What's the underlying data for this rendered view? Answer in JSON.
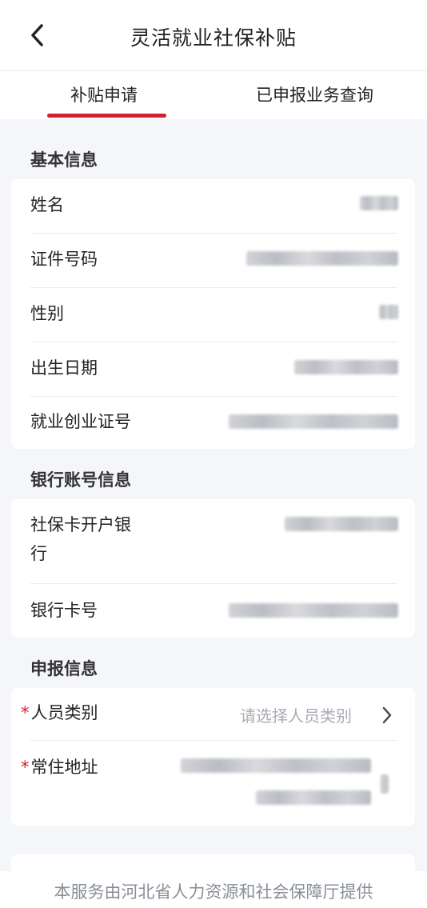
{
  "header": {
    "title": "灵活就业社保补贴"
  },
  "tabs": [
    {
      "label": "补贴申请",
      "active": true
    },
    {
      "label": "已申报业务查询",
      "active": false
    }
  ],
  "sections": {
    "basic": {
      "title": "基本信息",
      "fields": {
        "name": "姓名",
        "id_number": "证件号码",
        "gender": "性别",
        "birth_date": "出生日期",
        "employment_cert": "就业创业证号"
      }
    },
    "bank": {
      "title": "银行账号信息",
      "fields": {
        "bank_line1": "社保卡开户银",
        "bank_line2": "行",
        "card_number": "银行卡号"
      }
    },
    "apply": {
      "title": "申报信息",
      "required_mark": "*",
      "fields": {
        "person_type": "人员类别",
        "person_type_placeholder": "请选择人员类别",
        "address": "常住地址"
      }
    }
  },
  "footer": {
    "text": "本服务由河北省人力资源和社会保障厅提供"
  },
  "colors": {
    "accent": "#d0202e",
    "background": "#f4f6f9"
  }
}
